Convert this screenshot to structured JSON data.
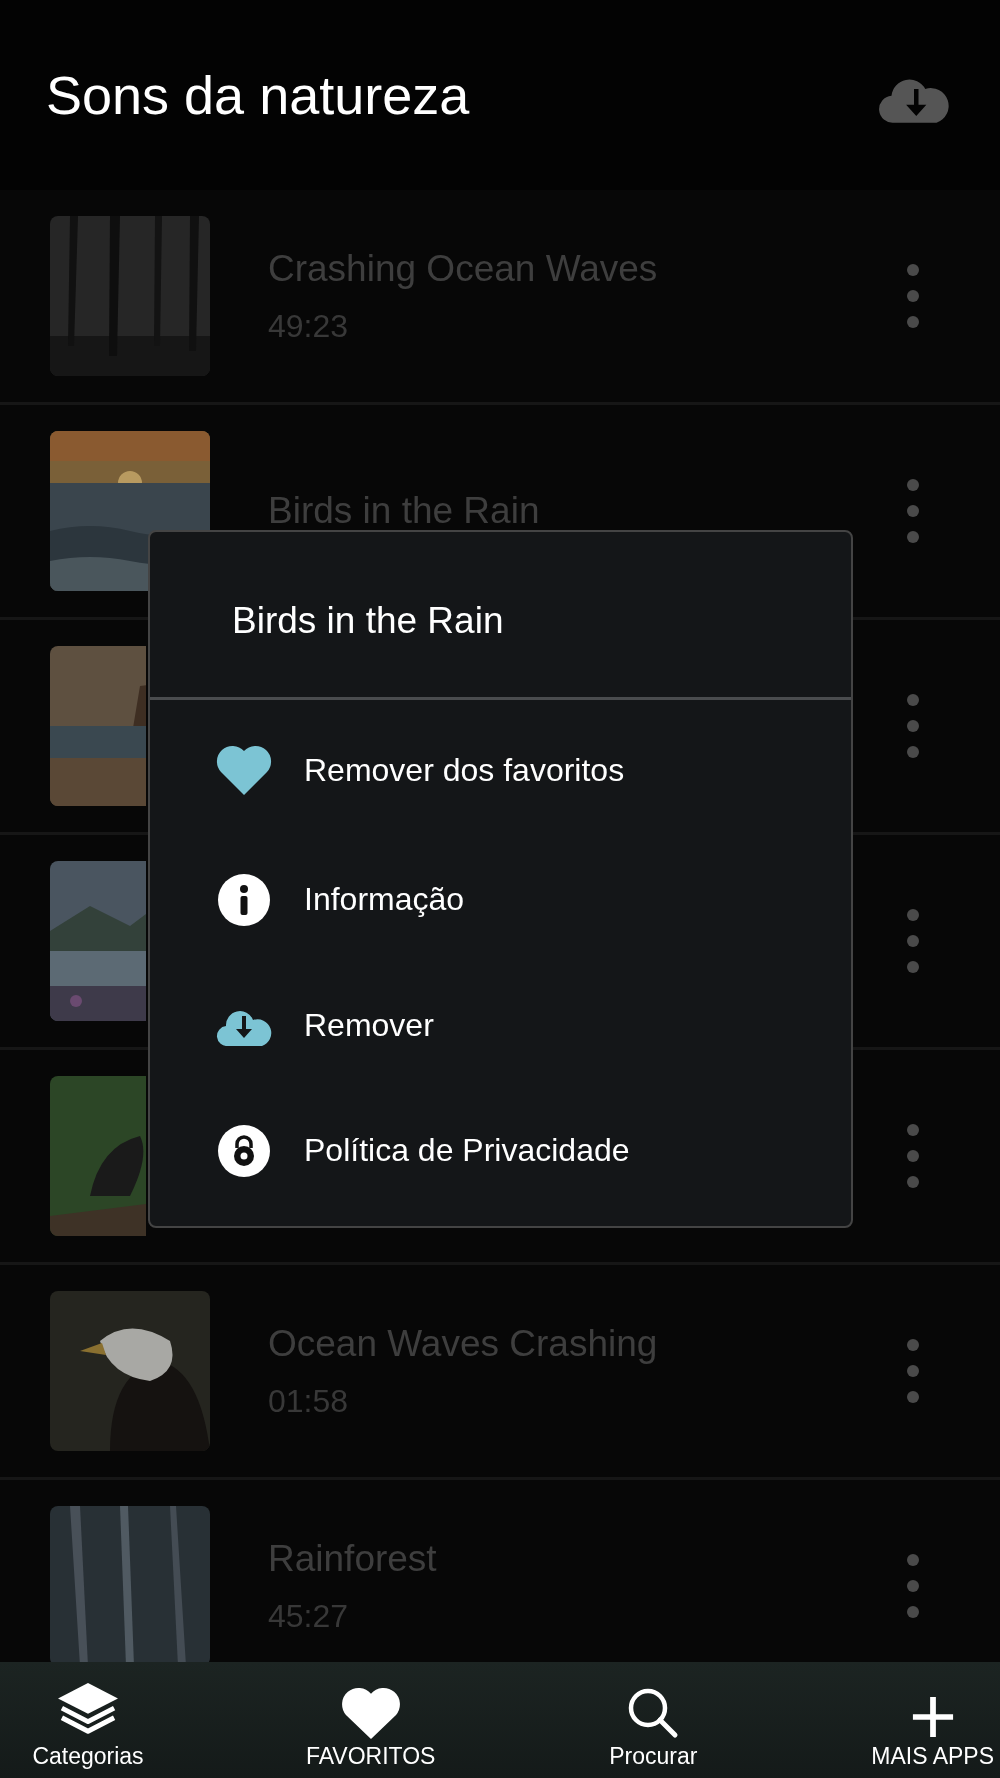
{
  "header": {
    "title": "Sons da natureza"
  },
  "tracks": [
    {
      "kind": "track",
      "title": "Crashing Ocean Waves",
      "duration": "49:23"
    },
    {
      "kind": "track",
      "title": "Birds in the Rain"
    },
    {
      "kind": "covered"
    },
    {
      "kind": "covered"
    },
    {
      "kind": "covered"
    },
    {
      "kind": "track",
      "title": "Ocean Waves Crashing",
      "duration": "01:58"
    },
    {
      "kind": "track",
      "title": "Rainforest",
      "duration": "45:27"
    }
  ],
  "dialog": {
    "title": "Birds in the Rain",
    "items": [
      {
        "kind": "favorite",
        "label": "Remover dos favoritos"
      },
      {
        "kind": "info",
        "label": "Informação"
      },
      {
        "kind": "download",
        "label": "Remover"
      },
      {
        "kind": "privacy",
        "label": "Política de Privacidade"
      }
    ]
  },
  "bottom_nav": [
    {
      "kind": "categories",
      "label": "Categorias"
    },
    {
      "kind": "favorites",
      "label": "FAVORITOS"
    },
    {
      "kind": "search",
      "label": "Procurar"
    },
    {
      "kind": "more",
      "label": "MAIS APPS"
    }
  ]
}
